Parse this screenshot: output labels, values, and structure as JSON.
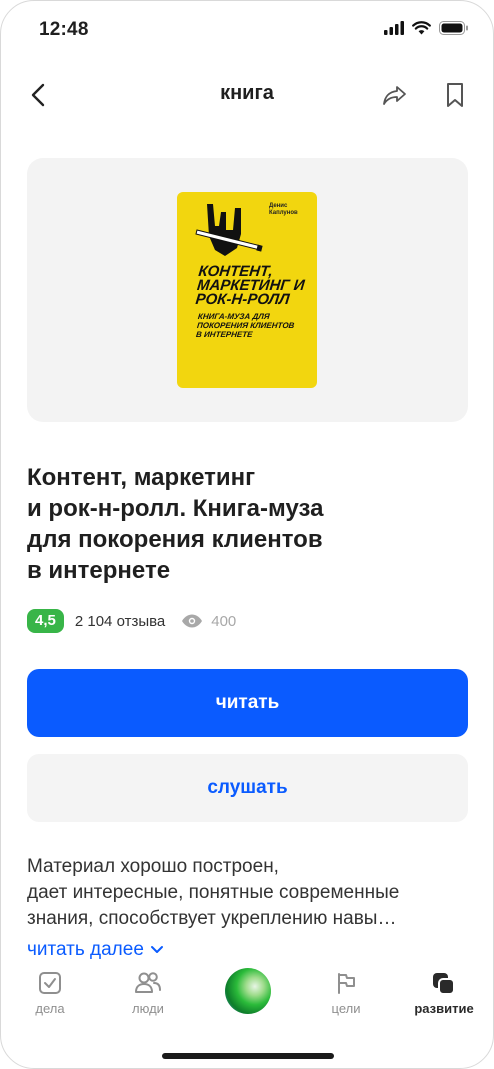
{
  "status_bar": {
    "time": "12:48"
  },
  "nav": {
    "title": "книга"
  },
  "cover": {
    "author": "Денис Каплунов",
    "title": "КОНТЕНТ, МАРКЕТИНГ И РОК-Н-РОЛЛ",
    "subtitle": "КНИГА-МУЗА ДЛЯ ПОКОРЕНИЯ КЛИЕНТОВ В ИНТЕРНЕТЕ",
    "color": "#f2d60f"
  },
  "book": {
    "title_lines": [
      "Контент, маркетинг",
      "и рок-н-ролл. Книга-муза",
      "для покорения клиентов",
      "в интернете"
    ],
    "rating": "4,5",
    "reviews": "2 104 отзыва",
    "views": "400"
  },
  "actions": {
    "read": "читать",
    "listen": "слушать"
  },
  "description": {
    "lines": [
      "Материал хорошо построен,",
      "дает интересные, понятные современные",
      "знания, способствует укреплению навы…"
    ],
    "more": "читать далее"
  },
  "tabs": [
    {
      "label": "дела",
      "icon": "checkbox-icon"
    },
    {
      "label": "люди",
      "icon": "people-icon"
    },
    {
      "label": "",
      "icon": "assistant-orb-icon"
    },
    {
      "label": "цели",
      "icon": "flag-icon"
    },
    {
      "label": "развитие",
      "icon": "development-icon"
    }
  ],
  "colors": {
    "accent": "#0a5bff",
    "rating": "#38b548"
  }
}
